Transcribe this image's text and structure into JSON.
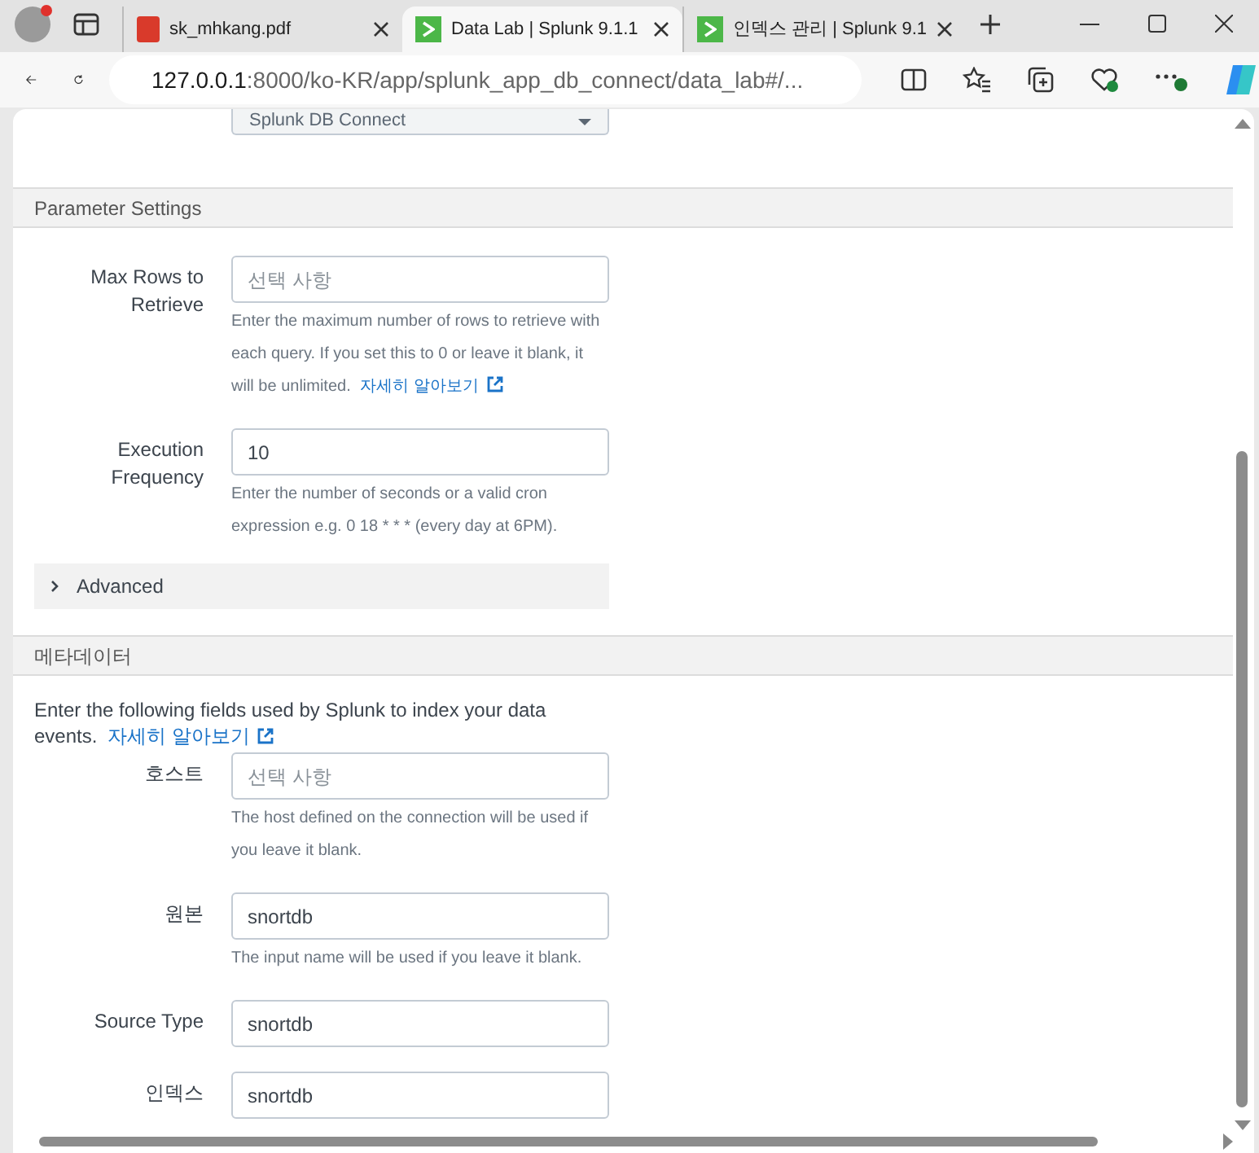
{
  "browser": {
    "tabs": [
      {
        "title": "sk_mhkang.pdf",
        "kind": "pdf",
        "selected": false
      },
      {
        "title": "Data Lab | Splunk 9.1.1",
        "kind": "splunk",
        "selected": true
      },
      {
        "title": "인덱스 관리 | Splunk 9.1",
        "kind": "splunk",
        "selected": false
      }
    ],
    "url_host": "127.0.0.1",
    "url_rest": ":8000/ko-KR/app/splunk_app_db_connect/data_lab#/..."
  },
  "top_dropdown": {
    "value": "Splunk DB Connect"
  },
  "sections": [
    {
      "title": "Parameter Settings",
      "fields": [
        {
          "label": "Max Rows to Retrieve",
          "placeholder": "선택 사항",
          "help": "Enter the maximum number of rows to retrieve with each query. If you set this to 0 or leave it blank, it will be unlimited.",
          "help_link": "자세히 알아보기"
        },
        {
          "label": "Execution Frequency",
          "value": "10",
          "help": "Enter the number of seconds or a valid cron expression e.g. 0 18 * * * (every day at 6PM)."
        }
      ],
      "advanced": {
        "label": "Advanced",
        "expanded": false
      }
    },
    {
      "title": "메타데이터",
      "intro": "Enter the following fields used by Splunk to index your data events.",
      "intro_link": "자세히 알아보기",
      "fields": [
        {
          "label": "호스트",
          "placeholder": "선택 사항",
          "help": "The host defined on the connection will be used if you leave it blank."
        },
        {
          "label": "원본",
          "value": "snortdb",
          "help": "The input name will be used if you leave it blank."
        },
        {
          "label": "Source Type",
          "value": "snortdb"
        },
        {
          "label": "인덱스",
          "value": "snortdb"
        }
      ]
    }
  ]
}
